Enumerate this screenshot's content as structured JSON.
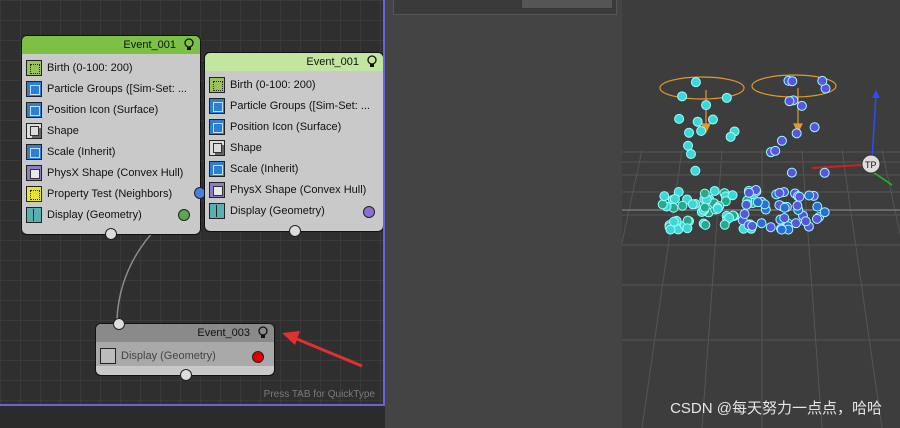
{
  "particle_view": {
    "footer_hint": "Press TAB for QuickType",
    "events": [
      {
        "title": "Event_001",
        "header_color": "#7cc046",
        "output_color": "#5aa84a",
        "operators": [
          {
            "label": "Birth (0-100: 200)",
            "icon": "birth-icon"
          },
          {
            "label": "Particle Groups ([Sim-Set: ...",
            "icon": "particle-groups-icon"
          },
          {
            "label": "Position Icon (Surface)",
            "icon": "position-icon"
          },
          {
            "label": "Shape",
            "icon": "shape-icon"
          },
          {
            "label": "Scale (Inherit)",
            "icon": "scale-icon"
          },
          {
            "label": "PhysX Shape (Convex Hull)",
            "icon": "physx-shape-icon"
          },
          {
            "label": "Property Test (Neighbors)",
            "icon": "property-test-icon"
          },
          {
            "label": "Display (Geometry)",
            "icon": "display-icon"
          }
        ]
      },
      {
        "title": "Event_001",
        "header_color": "#c2e6a0",
        "output_color": "#8a6fd6",
        "operators": [
          {
            "label": "Birth (0-100: 200)",
            "icon": "birth-icon"
          },
          {
            "label": "Particle Groups ([Sim-Set: ...",
            "icon": "particle-groups-icon"
          },
          {
            "label": "Position Icon (Surface)",
            "icon": "position-icon"
          },
          {
            "label": "Shape",
            "icon": "shape-icon"
          },
          {
            "label": "Scale (Inherit)",
            "icon": "scale-icon"
          },
          {
            "label": "PhysX Shape (Convex Hull)",
            "icon": "physx-shape-icon"
          },
          {
            "label": "Display (Geometry)",
            "icon": "display-icon"
          }
        ]
      },
      {
        "title": "Event_003",
        "header_color": "#8a8a8a",
        "output_color": "#e00000",
        "operators": [
          {
            "label": "Display (Geometry)",
            "icon": "display-icon"
          }
        ]
      }
    ]
  },
  "viewport": {
    "watermark": "CSDN @每天努力一点点，哈哈",
    "gizmo_label": "TP"
  },
  "colors": {
    "selection_border": "#6b62d8",
    "annotation_arrow": "#e03030",
    "particle_teal": "#3fd6d6",
    "particle_blue": "#5a55e0",
    "emitter_orange": "#e39a2a"
  }
}
